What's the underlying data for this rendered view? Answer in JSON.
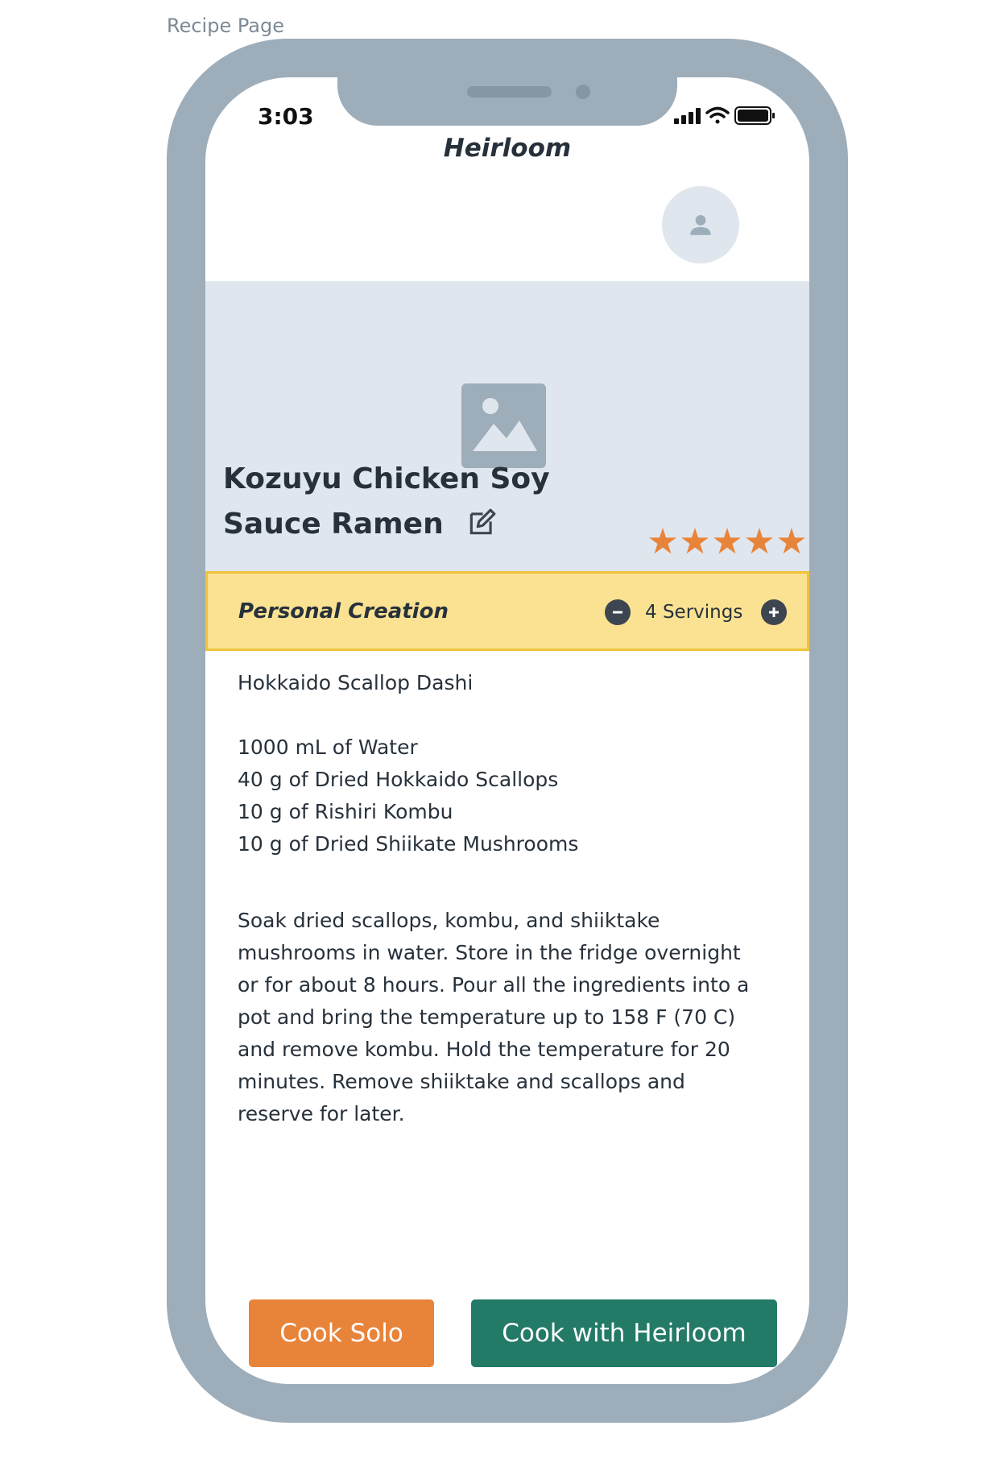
{
  "frame_label": "Recipe Page",
  "status_bar": {
    "time": "3:03"
  },
  "app": {
    "title": "Heirloom"
  },
  "recipe": {
    "title": "Kozuyu Chicken Soy Sauce Ramen",
    "rating": 5,
    "rating_max": 5,
    "creation_label": "Personal Creation",
    "servings_label": "4 Servings",
    "section_title": "Hokkaido Scallop Dashi",
    "ingredients": [
      "1000 mL of Water",
      "40 g of Dried Hokkaido Scallops",
      "10 g of Rishiri Kombu",
      "10 g of Dried Shiikate Mushrooms"
    ],
    "instructions": "Soak dried scallops, kombu, and shiiktake mushrooms in water. Store in the fridge overnight or for about 8 hours. Pour all the ingredients into a pot and bring the temperature up to 158 F (70 C) and remove kombu. Hold the temperature for 20 minutes. Remove shiiktake and scallops and reserve for later."
  },
  "buttons": {
    "cook_solo": "Cook Solo",
    "cook_with": "Cook with Heirloom"
  },
  "colors": {
    "accent_orange": "#e8843a",
    "accent_green": "#237a67",
    "banner_yellow": "#fae292",
    "device_gray": "#9dadba"
  },
  "icons": {
    "avatar": "user-icon",
    "hero": "image-placeholder-icon",
    "edit": "edit-icon",
    "decrease": "minus-circle-icon",
    "increase": "plus-circle-icon",
    "signal": "signal-icon",
    "wifi": "wifi-icon",
    "battery": "battery-icon"
  }
}
